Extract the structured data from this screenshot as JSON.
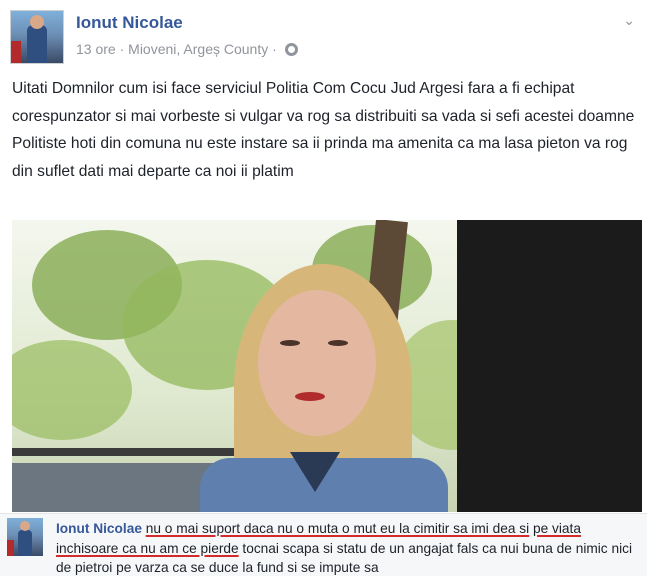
{
  "post": {
    "author": "Ionut Nicolae",
    "time": "13 ore",
    "separator": "·",
    "location": "Mioveni, Argeș County",
    "privacy_dot": "·",
    "privacy_icon": "globe-icon",
    "menu_icon": "chevron-down-icon",
    "text": "Uitati Domnilor cum isi face serviciul Politia Com Cocu Jud Argesi fara a fi echipat corespunzator si mai vorbeste si vulgar va rog sa distribuiti sa vada si sefi acestei doamne Politiste hoti din comuna nu este instare sa ii prinda ma amenita ca ma lasa pieton va rog din suflet dati mai departe ca noi ii platim"
  },
  "comment": {
    "author": "Ionut Nicolae",
    "underlined_part1": "nu o mai suport daca nu o muta o mut eu la cimitir sa imi dea si",
    "underlined_part2": "pe viata inchisoare ca nu am ce pierde",
    "rest": "tocnai scapa si statu de un angajat fals ca nui buna de nimic nici de pietroi pe varza ca se duce la fund si se impute sa"
  },
  "colors": {
    "link": "#365899",
    "meta": "#90949c",
    "underline": "#d12b2b"
  }
}
